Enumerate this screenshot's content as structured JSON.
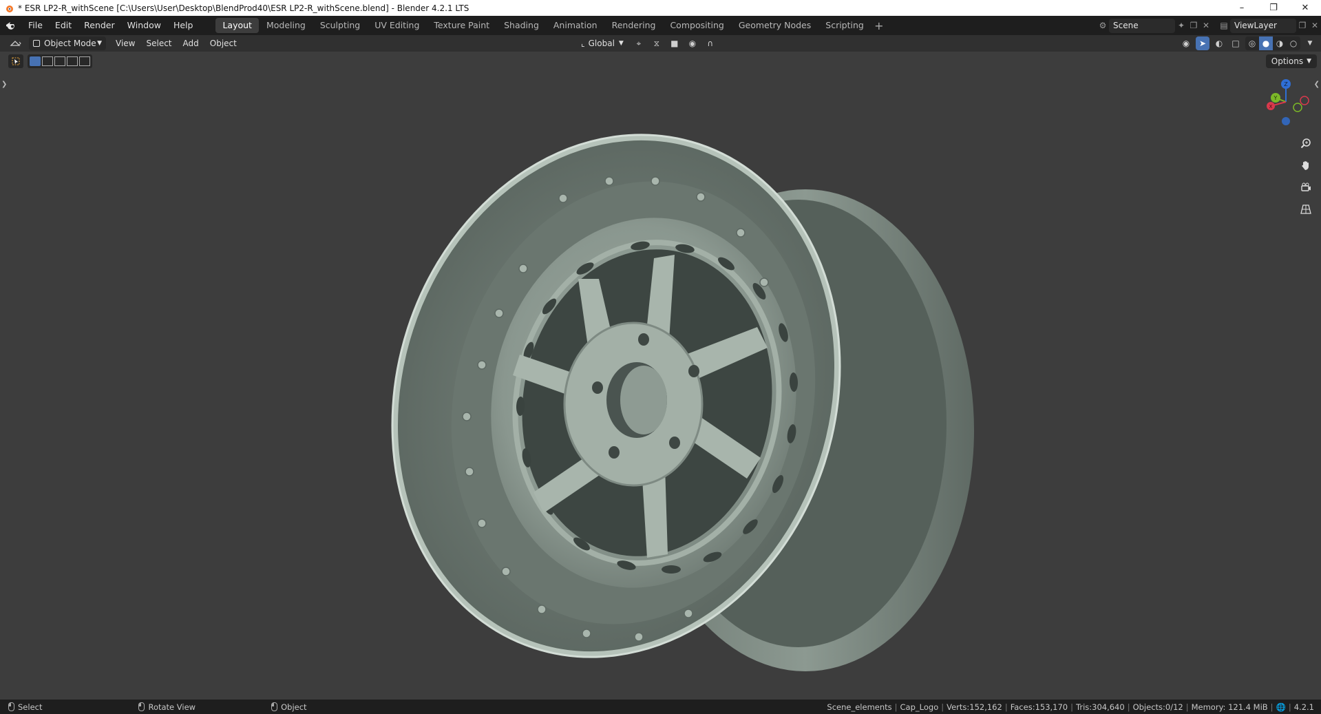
{
  "window": {
    "title": "* ESR LP2-R_withScene [C:\\Users\\User\\Desktop\\BlendProd40\\ESR LP2-R_withScene.blend] - Blender 4.2.1 LTS",
    "minimize": "–",
    "maximize": "❐",
    "close": "✕"
  },
  "menu": {
    "file": "File",
    "edit": "Edit",
    "render": "Render",
    "window": "Window",
    "help": "Help"
  },
  "workspaces": [
    "Layout",
    "Modeling",
    "Sculpting",
    "UV Editing",
    "Texture Paint",
    "Shading",
    "Animation",
    "Rendering",
    "Compositing",
    "Geometry Nodes",
    "Scripting"
  ],
  "active_workspace": "Layout",
  "scene": {
    "scene_name": "Scene",
    "view_layer": "ViewLayer"
  },
  "viewport_header": {
    "mode": "Object Mode",
    "view": "View",
    "select": "Select",
    "add": "Add",
    "object": "Object",
    "transform_orientation": "Global",
    "options": "Options"
  },
  "gizmo": {
    "z": "Z",
    "y": "Y",
    "x": "X"
  },
  "status": {
    "select": "Select",
    "rotate_view": "Rotate View",
    "object": "Object",
    "collection": "Scene_elements",
    "active_object": "Cap_Logo",
    "verts": "Verts:152,162",
    "faces": "Faces:153,170",
    "tris": "Tris:304,640",
    "objects": "Objects:0/12",
    "memory": "Memory: 121.4 MiB",
    "version": "4.2.1"
  },
  "colors": {
    "accent": "#4772b3",
    "wheel": "#9aa89f",
    "background": "#3d3d3d"
  }
}
